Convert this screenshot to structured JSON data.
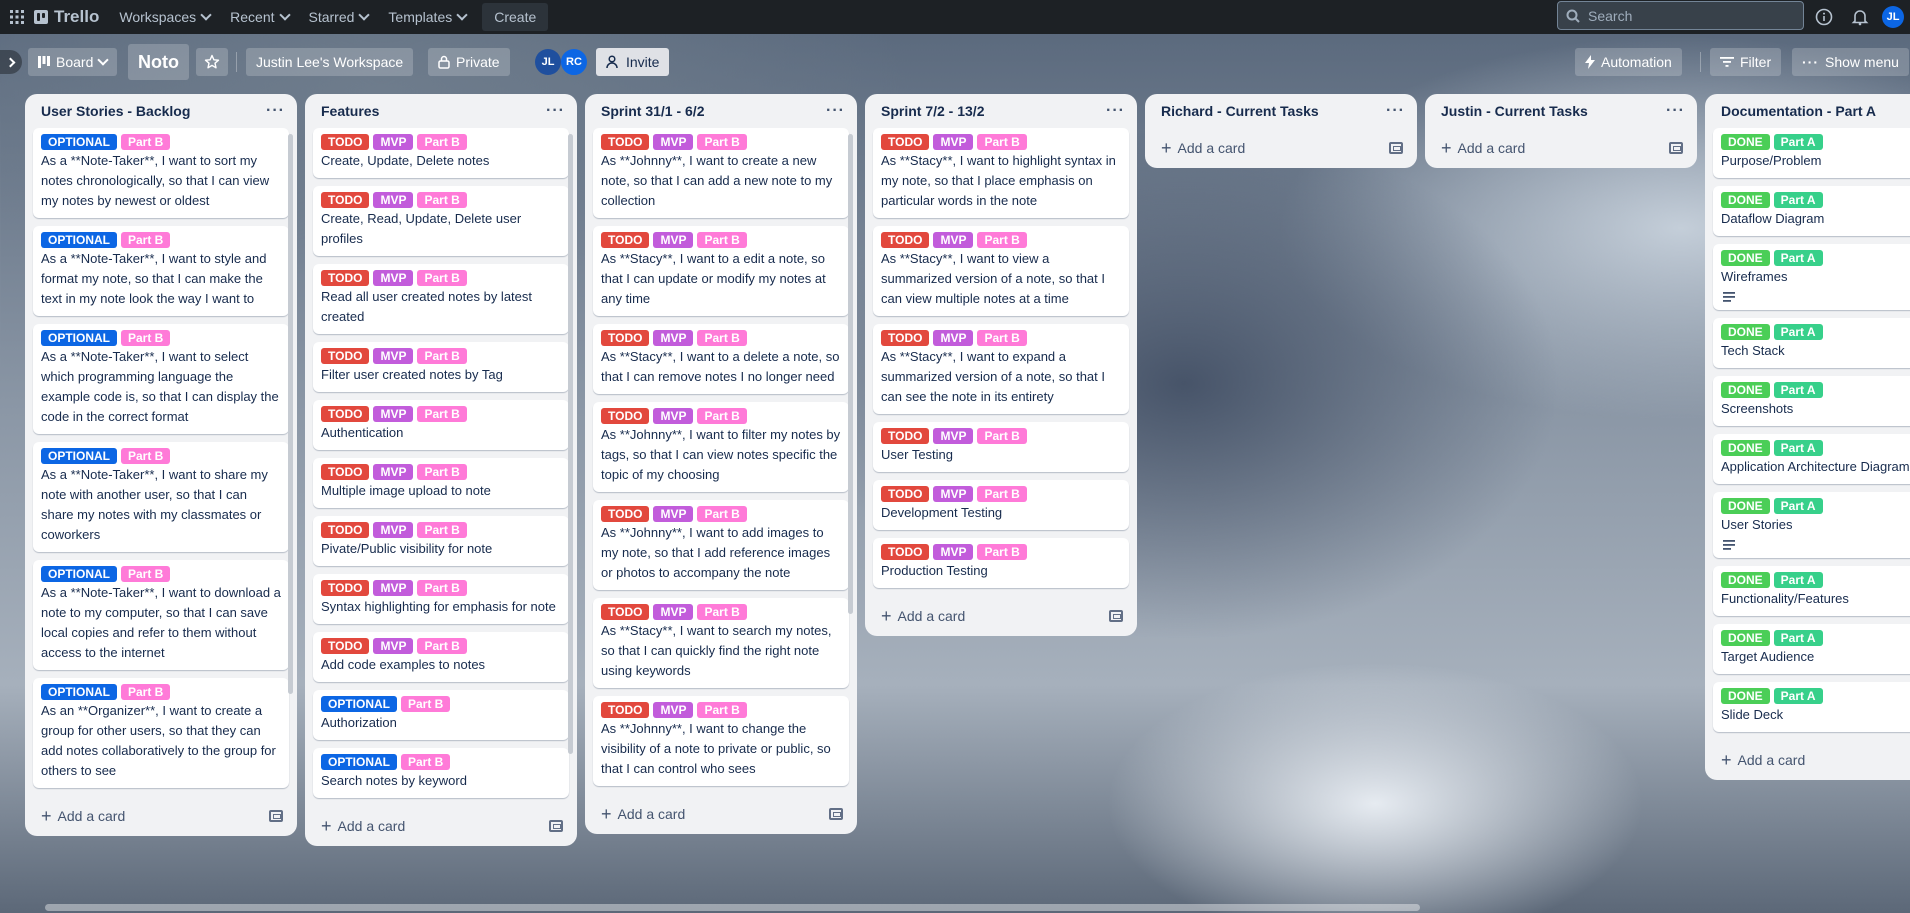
{
  "colors": {
    "todo": "#e2483d",
    "mvp": "#c25cdb",
    "partB": "#ff7ad8",
    "optional": "#0c66e4",
    "done": "#4bce57",
    "partA": "#37d08a"
  },
  "topbar": {
    "logo": "Trello",
    "workspaces": "Workspaces",
    "recent": "Recent",
    "starred": "Starred",
    "templates": "Templates",
    "create": "Create",
    "search_placeholder": "Search",
    "user_initials": "JL"
  },
  "board": {
    "view": "Board",
    "name": "Noto",
    "workspace": "Justin Lee's Workspace",
    "visibility": "Private",
    "members": [
      "JL",
      "RC"
    ],
    "invite": "Invite",
    "automation": "Automation",
    "filter": "Filter",
    "show_menu": "Show menu"
  },
  "add_card_label": "Add a card",
  "lists": [
    {
      "title": "User Stories - Backlog",
      "cards": [
        {
          "labels": [
            "OPTIONAL",
            "Part B"
          ],
          "text": "As a **Note-Taker**, I want to sort my notes chronologically, so that I can view my notes by newest or oldest"
        },
        {
          "labels": [
            "OPTIONAL",
            "Part B"
          ],
          "text": "As a **Note-Taker**, I want to style and format my note, so that I can make the text in my note look the way I want to"
        },
        {
          "labels": [
            "OPTIONAL",
            "Part B"
          ],
          "text": "As a **Note-Taker**, I want to select which programming language the example code is, so that I can display the code in the correct format"
        },
        {
          "labels": [
            "OPTIONAL",
            "Part B"
          ],
          "text": "As a **Note-Taker**, I want to share my note with another user, so that I can share my notes with my classmates or coworkers"
        },
        {
          "labels": [
            "OPTIONAL",
            "Part B"
          ],
          "text": "As a **Note-Taker**, I want to download a note to my computer, so that I can save local copies and refer to them without access to the internet"
        },
        {
          "labels": [
            "OPTIONAL",
            "Part B"
          ],
          "text": "As an **Organizer**, I want to create a group for other users, so that they can add notes collaboratively to the group for others to see"
        }
      ]
    },
    {
      "title": "Features",
      "cards": [
        {
          "labels": [
            "TODO",
            "MVP",
            "Part B"
          ],
          "text": "Create, Update, Delete notes"
        },
        {
          "labels": [
            "TODO",
            "MVP",
            "Part B"
          ],
          "text": "Create, Read, Update, Delete user profiles"
        },
        {
          "labels": [
            "TODO",
            "MVP",
            "Part B"
          ],
          "text": "Read all user created notes by latest created"
        },
        {
          "labels": [
            "TODO",
            "MVP",
            "Part B"
          ],
          "text": "Filter user created notes by Tag"
        },
        {
          "labels": [
            "TODO",
            "MVP",
            "Part B"
          ],
          "text": "Authentication"
        },
        {
          "labels": [
            "TODO",
            "MVP",
            "Part B"
          ],
          "text": "Multiple image upload to note"
        },
        {
          "labels": [
            "TODO",
            "MVP",
            "Part B"
          ],
          "text": "Pivate/Public visibility for note"
        },
        {
          "labels": [
            "TODO",
            "MVP",
            "Part B"
          ],
          "text": "Syntax highlighting for emphasis for note"
        },
        {
          "labels": [
            "TODO",
            "MVP",
            "Part B"
          ],
          "text": "Add code examples to notes"
        },
        {
          "labels": [
            "OPTIONAL",
            "Part B"
          ],
          "text": "Authorization"
        },
        {
          "labels": [
            "OPTIONAL",
            "Part B"
          ],
          "text": "Search notes by keyword"
        }
      ]
    },
    {
      "title": "Sprint 31/1 - 6/2",
      "cards": [
        {
          "labels": [
            "TODO",
            "MVP",
            "Part B"
          ],
          "text": "As **Johnny**, I want to create a new note, so that I can add a new note to my collection"
        },
        {
          "labels": [
            "TODO",
            "MVP",
            "Part B"
          ],
          "text": "As **Stacy**, I want to a edit a note, so that I can update or modify my notes at any time"
        },
        {
          "labels": [
            "TODO",
            "MVP",
            "Part B"
          ],
          "text": "As **Stacy**, I want to a delete a note, so that I can remove notes I no longer need"
        },
        {
          "labels": [
            "TODO",
            "MVP",
            "Part B"
          ],
          "text": "As **Johnny**, I want to filter my notes by tags, so that I can view notes specific the topic of my choosing"
        },
        {
          "labels": [
            "TODO",
            "MVP",
            "Part B"
          ],
          "text": "As **Johnny**, I want to add images to my note, so that I add reference images or photos to accompany the note"
        },
        {
          "labels": [
            "TODO",
            "MVP",
            "Part B"
          ],
          "text": "As **Stacy**, I want to search my notes, so that I can quickly find the right note using keywords"
        },
        {
          "labels": [
            "TODO",
            "MVP",
            "Part B"
          ],
          "text": "As **Johnny**, I want to change the visibility of a note to private or public, so that I can control who sees"
        }
      ]
    },
    {
      "title": "Sprint 7/2 - 13/2",
      "cards": [
        {
          "labels": [
            "TODO",
            "MVP",
            "Part B"
          ],
          "text": "As **Stacy**, I want to highlight syntax in my note, so that I place emphasis on particular words in the note"
        },
        {
          "labels": [
            "TODO",
            "MVP",
            "Part B"
          ],
          "text": "As **Stacy**, I want to view a summarized version of a note, so that I can view multiple notes at a time"
        },
        {
          "labels": [
            "TODO",
            "MVP",
            "Part B"
          ],
          "text": "As **Stacy**, I want to expand a summarized version of a note, so that I can see the note in its entirety"
        },
        {
          "labels": [
            "TODO",
            "MVP",
            "Part B"
          ],
          "text": "User Testing"
        },
        {
          "labels": [
            "TODO",
            "MVP",
            "Part B"
          ],
          "text": "Development Testing"
        },
        {
          "labels": [
            "TODO",
            "MVP",
            "Part B"
          ],
          "text": "Production Testing"
        }
      ]
    },
    {
      "title": "Richard - Current Tasks",
      "cards": []
    },
    {
      "title": "Justin - Current Tasks",
      "cards": []
    },
    {
      "title": "Documentation - Part A",
      "cards": [
        {
          "labels": [
            "DONE",
            "Part A"
          ],
          "text": "Purpose/Problem"
        },
        {
          "labels": [
            "DONE",
            "Part A"
          ],
          "text": "Dataflow Diagram"
        },
        {
          "labels": [
            "DONE",
            "Part A"
          ],
          "text": "Wireframes",
          "description": true
        },
        {
          "labels": [
            "DONE",
            "Part A"
          ],
          "text": "Tech Stack"
        },
        {
          "labels": [
            "DONE",
            "Part A"
          ],
          "text": "Screenshots"
        },
        {
          "labels": [
            "DONE",
            "Part A"
          ],
          "text": "Application Architecture Diagram"
        },
        {
          "labels": [
            "DONE",
            "Part A"
          ],
          "text": "User Stories",
          "description": true
        },
        {
          "labels": [
            "DONE",
            "Part A"
          ],
          "text": "Functionality/Features"
        },
        {
          "labels": [
            "DONE",
            "Part A"
          ],
          "text": "Target Audience"
        },
        {
          "labels": [
            "DONE",
            "Part A"
          ],
          "text": "Slide Deck"
        }
      ]
    }
  ]
}
